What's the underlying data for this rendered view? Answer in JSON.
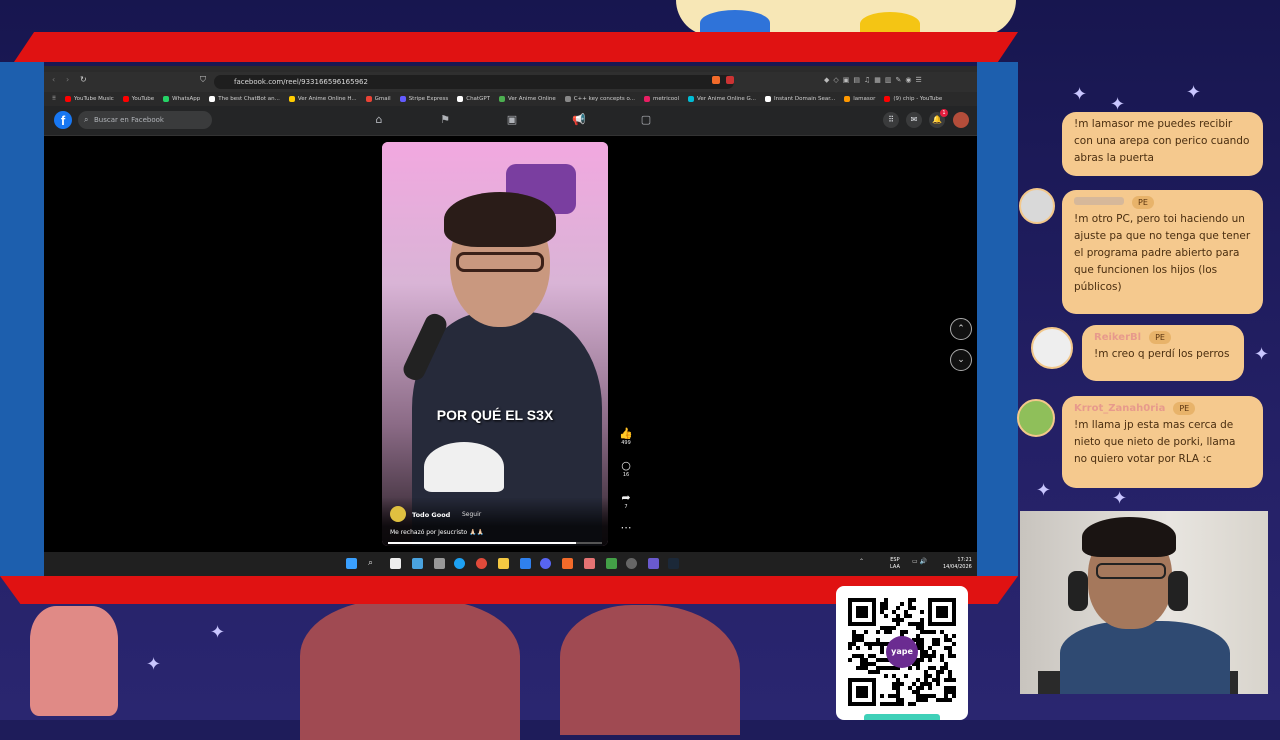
{
  "browser": {
    "url": "facebook.com/reel/933166596165962",
    "bookmarks": [
      {
        "label": "YouTube Music",
        "color": "#ff0000"
      },
      {
        "label": "YouTube",
        "color": "#ff0000"
      },
      {
        "label": "WhatsApp",
        "color": "#25d366"
      },
      {
        "label": "The best ChatBot an...",
        "color": "#ffffff"
      },
      {
        "label": "Ver Anime Online H...",
        "color": "#ffcc00"
      },
      {
        "label": "Gmail",
        "color": "#ea4335"
      },
      {
        "label": "Stripe Express",
        "color": "#635bff"
      },
      {
        "label": "ChatGPT",
        "color": "#ffffff"
      },
      {
        "label": "Ver Anime Online",
        "color": "#4caf50"
      },
      {
        "label": "C++ key concepts o...",
        "color": "#888888"
      },
      {
        "label": "metricool",
        "color": "#e91e63"
      },
      {
        "label": "Ver Anime Online G...",
        "color": "#00bcd4"
      },
      {
        "label": "Instant Domain Sear...",
        "color": "#ffffff"
      },
      {
        "label": "lamasor",
        "color": "#ff9800"
      },
      {
        "label": "(9) chip - YouTube",
        "color": "#ff0000"
      }
    ]
  },
  "facebook": {
    "logo": "f",
    "search_placeholder": "Buscar en Facebook",
    "notification_count": "1"
  },
  "reel": {
    "caption": "POR QUÉ EL S3X",
    "author": "Todo Good",
    "follow_label": "Seguir",
    "description": "Me rechazó por Jesucristo 🙏🏻🙏🏻",
    "likes": "499",
    "comments": "16",
    "shares": "7",
    "progress": 0.88
  },
  "taskbar": {
    "lang": "ESP",
    "lang_sub": "LAA",
    "time": "17:21",
    "date": "14/04/2026"
  },
  "chat": [
    {
      "user": "",
      "badge": "",
      "text": "!m lamasor me puedes recibir con una arepa con perico cuando abras la puerta"
    },
    {
      "user": "",
      "badge": "PE",
      "text": "!m otro PC, pero toi haciendo un ajuste pa que no tenga que tener el programa padre abierto para que funcionen los hijos (los públicos)"
    },
    {
      "user": "ReikerBl",
      "badge": "PE",
      "text": "!m creo q perdí los perros"
    },
    {
      "user": "Krrot_Zanah0ria",
      "badge": "PE",
      "text": "!m llama jp esta mas cerca de nieto que nieto de porki, llama no quiero votar por RLA :c"
    }
  ],
  "qr": {
    "brand": "yape"
  },
  "colors": {
    "frame_red": "#e01212",
    "chat_bubble": "#f5c98e",
    "fb_blue": "#1877f2"
  }
}
